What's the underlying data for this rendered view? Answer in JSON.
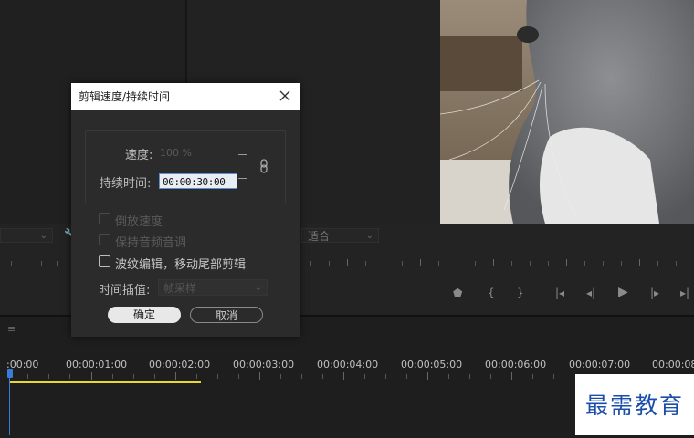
{
  "dialog": {
    "title": "剪辑速度/持续时间",
    "speed_label": "速度:",
    "speed_value": "100 %",
    "duration_label": "持续时间:",
    "duration_value": "00:00:30:00",
    "options": {
      "reverse": "倒放速度",
      "maintain_audio": "保持音频音调",
      "ripple": "波纹编辑，移动尾部剪辑"
    },
    "interp_label": "时间插值:",
    "interp_value": "帧采样",
    "ok": "确定",
    "cancel": "取消"
  },
  "monitor": {
    "fit_value": "适合"
  },
  "timeline": {
    "timecodes": [
      ":00:00",
      "00:00:01:00",
      "00:00:02:00",
      "00:00:03:00",
      "00:00:04:00",
      "00:00:05:00",
      "00:00:06:00",
      "00:00:07:00",
      "00:00:08:"
    ]
  },
  "watermark": "最需教育",
  "colors": {
    "playhead": "#3a7bd5",
    "inout_bar": "#e9d82e",
    "watermark_text": "#1b4ea8"
  }
}
